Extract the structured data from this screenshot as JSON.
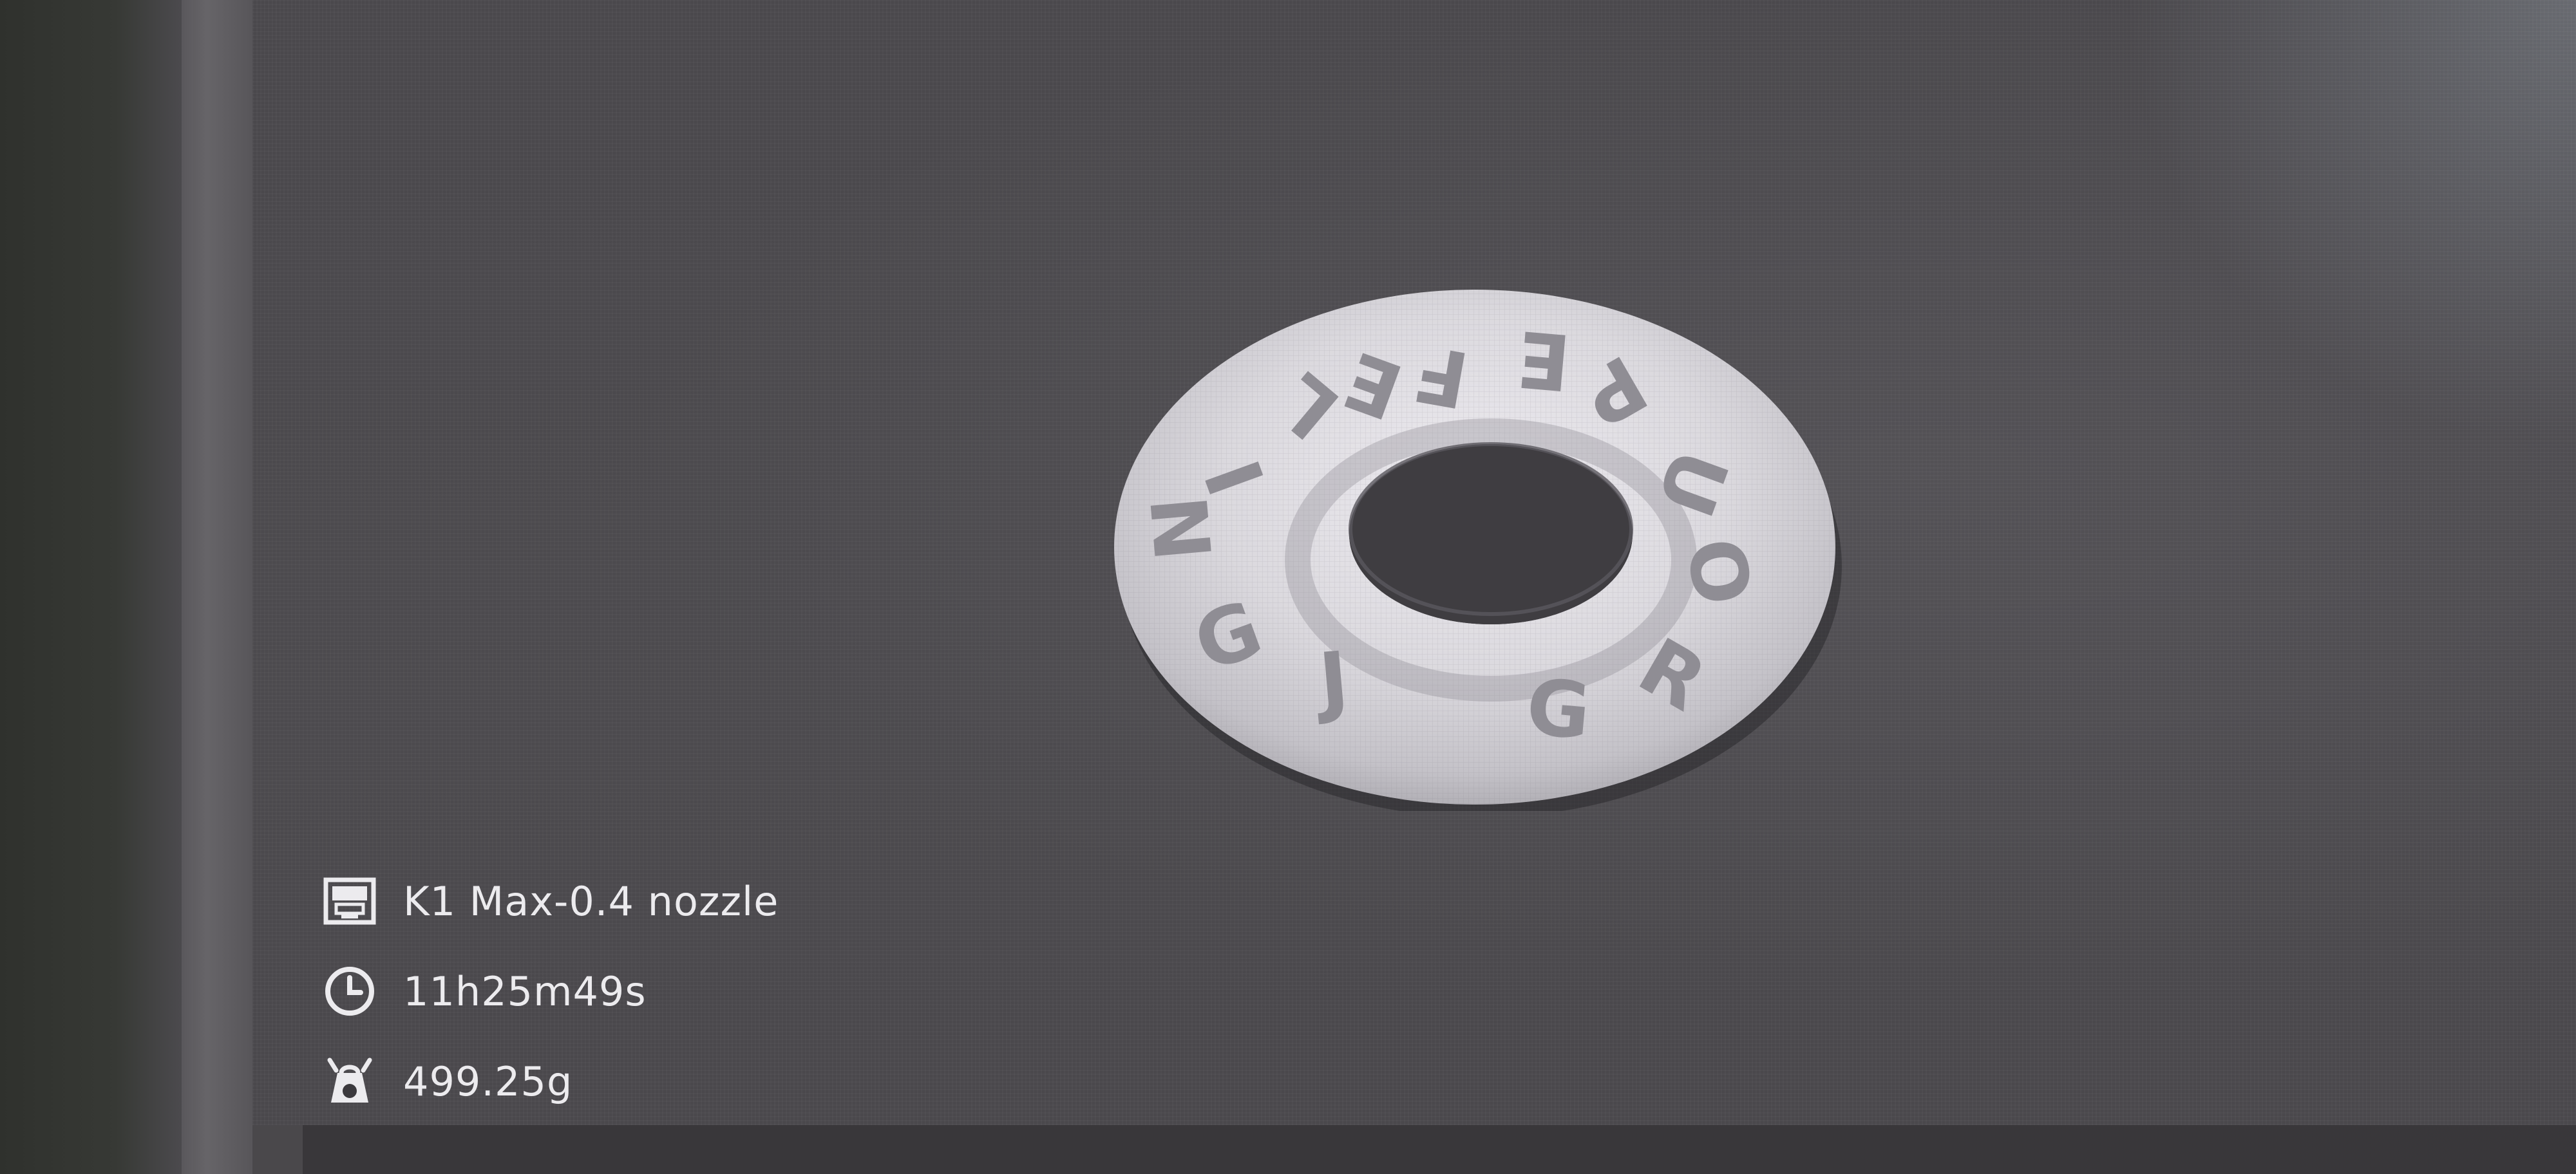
{
  "slice_info": {
    "printer": {
      "icon": "printer-preset-icon",
      "label": "K1 Max-0.4 nozzle"
    },
    "time": {
      "icon": "clock-icon",
      "label": "11h25m49s"
    },
    "weight": {
      "icon": "weight-scale-icon",
      "label": "499.25g"
    }
  },
  "model": {
    "name": "torus-model",
    "embossed_text": "FEELING GROUP",
    "color": "#d7d5da"
  },
  "colors": {
    "viewport_bg": "#4a484c",
    "text": "#ecebee"
  }
}
